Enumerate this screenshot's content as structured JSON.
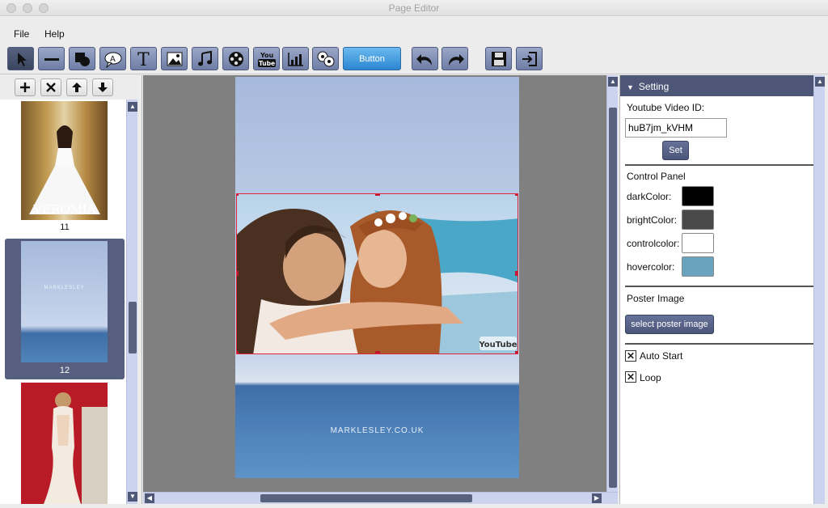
{
  "window": {
    "title": "Page Editor"
  },
  "menu": {
    "items": [
      "File",
      "Help"
    ]
  },
  "toolbar": {
    "tools": [
      "pointer-icon",
      "line-icon",
      "shape-icon",
      "comment-bubble-icon",
      "text-icon",
      "image-icon",
      "music-icon",
      "video-reel-icon",
      "youtube-icon",
      "chart-icon",
      "quiz-icon"
    ],
    "button_label": "Button",
    "youtube_top": "You",
    "youtube_bottom": "Tube",
    "actions": [
      "undo-icon",
      "redo-icon",
      "save-icon",
      "export-icon"
    ]
  },
  "pages_panel": {
    "tools": [
      "add-icon",
      "delete-icon",
      "move-up-icon",
      "move-down-icon"
    ],
    "thumbnails": [
      {
        "number": "11",
        "caption": "VEROMIA"
      },
      {
        "number": "12",
        "caption": "MARKLESLEY",
        "selected": true
      },
      {
        "number": "",
        "caption": ""
      }
    ]
  },
  "canvas": {
    "site_text": "MARKLESLEY.CO.UK",
    "video_watermark": "YouTube"
  },
  "settings": {
    "header": "Setting",
    "video_id_label": "Youtube Video ID:",
    "video_id_value": "huB7jm_kVHM",
    "set_label": "Set",
    "control_panel_label": "Control Panel",
    "colors": [
      {
        "label": "darkColor:",
        "value": "#000000"
      },
      {
        "label": "brightColor:",
        "value": "#4a4a4a"
      },
      {
        "label": "controlcolor:",
        "value": "#ffffff"
      },
      {
        "label": "hovercolor:",
        "value": "#6aa3bd"
      }
    ],
    "poster_label": "Poster Image",
    "poster_button": "select poster image",
    "auto_start_label": "Auto Start",
    "auto_start_checked": true,
    "loop_label": "Loop",
    "loop_checked": true
  }
}
